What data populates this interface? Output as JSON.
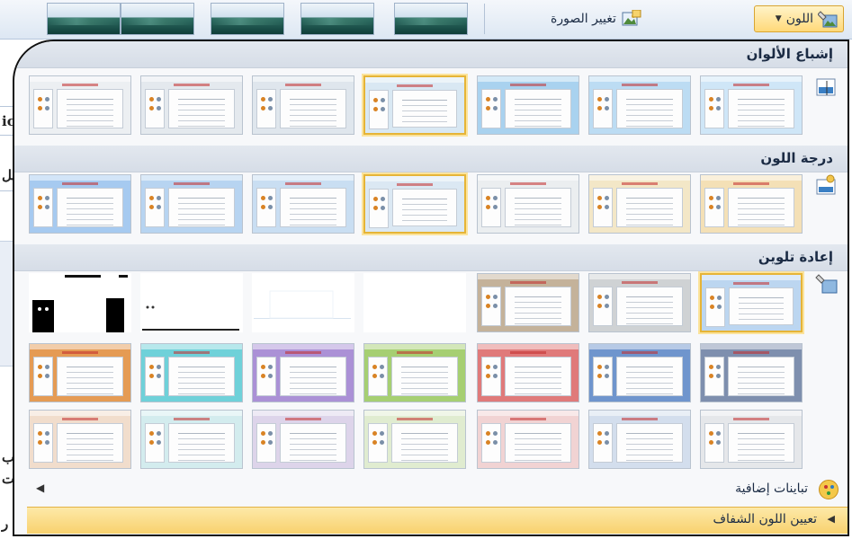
{
  "ribbon": {
    "change_picture_label": "تغيير الصورة",
    "color_button_label": "اللون",
    "picture_style_thumbs": 5
  },
  "sections": {
    "saturation_title": "إشباع الألوان",
    "tone_title": "درجة اللون",
    "recolor_title": "إعادة تلوين"
  },
  "footer": {
    "more_variants_label": "تباينات إضافية",
    "set_transparent_label": "تعيين اللون الشفاف"
  },
  "background": {
    "chars": [
      "ic",
      "عل",
      "ب",
      "ت",
      "ر"
    ]
  },
  "colors": {
    "accent_border": "#e6b437",
    "panel_bg": "#f7f8fa",
    "header_bg": "#dde3eb",
    "highlight_bg": "#fde9a8"
  },
  "galleries": {
    "saturation": {
      "selected_index": 3,
      "tints": [
        "#cfe6f7",
        "#bcdcf3",
        "#a9d2ef",
        "#d9e8f3",
        "#dfe6ed",
        "#e4e9ee",
        "#eceff2"
      ]
    },
    "tone": {
      "selected_index": 3,
      "tints": [
        "#f4e0b6",
        "#f3e7c7",
        "#ebeef0",
        "#dbe8f3",
        "#c9def2",
        "#b7d4f1",
        "#a6caf0"
      ]
    },
    "recolor_row1": {
      "selected_index": 0,
      "tints": [
        "#bcd6f0",
        "#cfd2d4",
        "#c4b29a",
        "#ffffff",
        "#ffffff",
        "#ffffff",
        "#ffffff"
      ]
    },
    "recolor_row2": {
      "tints": [
        "#7e8fae",
        "#6f95cd",
        "#e07a7a",
        "#a6cf72",
        "#ab91d6",
        "#6fd1d9",
        "#e59b54"
      ]
    },
    "recolor_row3": {
      "tints": [
        "#e5e7ea",
        "#d3deed",
        "#f1d3d3",
        "#e0ecd0",
        "#ddd4ea",
        "#d3ecee",
        "#f1ddcc"
      ]
    }
  }
}
